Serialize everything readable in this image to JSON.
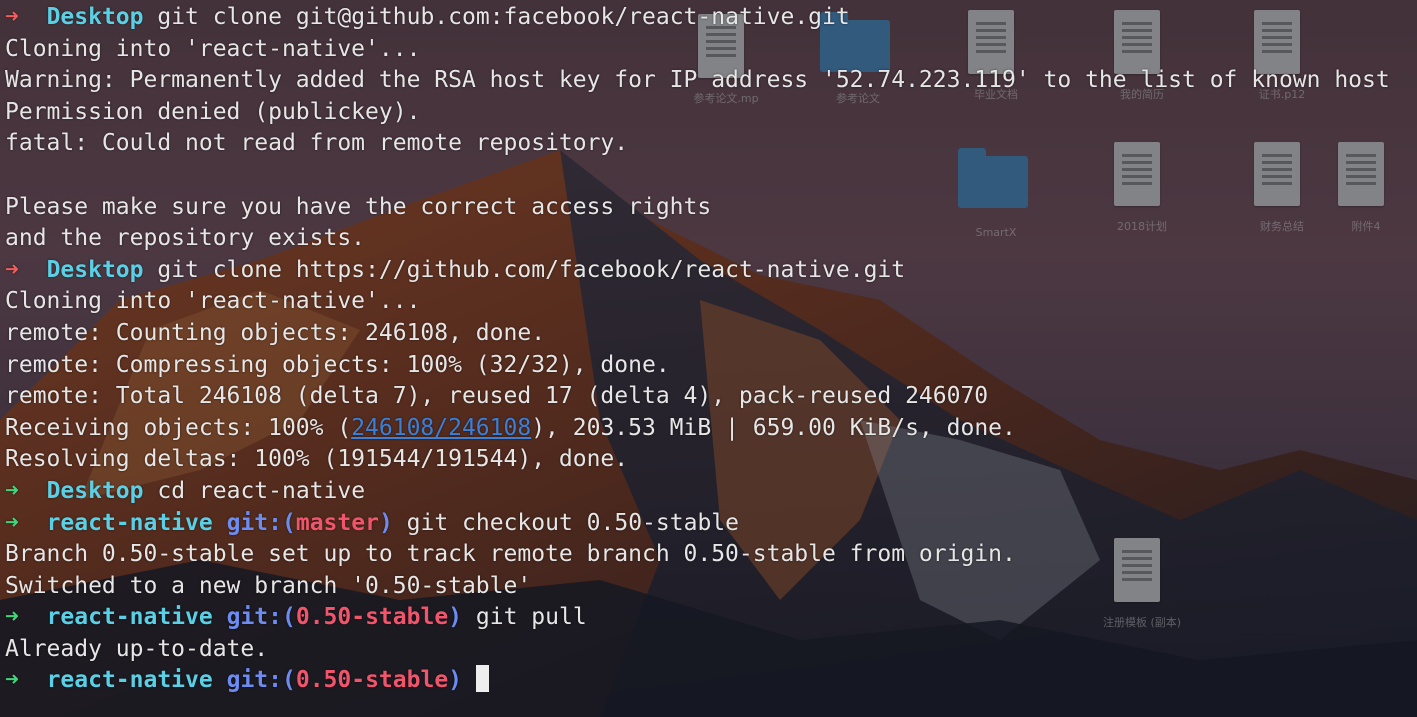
{
  "terminal": {
    "lines": [
      {
        "type": "prompt",
        "arrow": "err",
        "dir": "Desktop",
        "git": "",
        "branch": "",
        "git_end": "",
        "cmd": "git clone git@github.com:facebook/react-native.git"
      },
      {
        "type": "output",
        "text": "Cloning into 'react-native'..."
      },
      {
        "type": "output",
        "text": "Warning: Permanently added the RSA host key for IP address '52.74.223.119' to the list of known host"
      },
      {
        "type": "output",
        "text": "Permission denied (publickey)."
      },
      {
        "type": "output",
        "text": "fatal: Could not read from remote repository."
      },
      {
        "type": "output",
        "text": ""
      },
      {
        "type": "output",
        "text": "Please make sure you have the correct access rights"
      },
      {
        "type": "output",
        "text": "and the repository exists."
      },
      {
        "type": "prompt",
        "arrow": "err",
        "dir": "Desktop",
        "git": "",
        "branch": "",
        "git_end": "",
        "cmd": "git clone https://github.com/facebook/react-native.git"
      },
      {
        "type": "output",
        "text": "Cloning into 'react-native'..."
      },
      {
        "type": "output",
        "text": "remote: Counting objects: 246108, done."
      },
      {
        "type": "output",
        "text": "remote: Compressing objects: 100% (32/32), done."
      },
      {
        "type": "output",
        "text": "remote: Total 246108 (delta 7), reused 17 (delta 4), pack-reused 246070"
      },
      {
        "type": "receiving",
        "pre": "Receiving objects: 100% (",
        "link": "246108/246108",
        "post": "), 203.53 MiB | 659.00 KiB/s, done."
      },
      {
        "type": "output",
        "text": "Resolving deltas: 100% (191544/191544), done."
      },
      {
        "type": "prompt",
        "arrow": "ok",
        "dir": "Desktop",
        "git": "",
        "branch": "",
        "git_end": "",
        "cmd": "cd react-native"
      },
      {
        "type": "prompt",
        "arrow": "ok",
        "dir": "react-native",
        "git": "git:(",
        "branch": "master",
        "git_end": ")",
        "cmd": "git checkout 0.50-stable"
      },
      {
        "type": "output",
        "text": "Branch 0.50-stable set up to track remote branch 0.50-stable from origin."
      },
      {
        "type": "output",
        "text": "Switched to a new branch '0.50-stable'"
      },
      {
        "type": "prompt",
        "arrow": "ok",
        "dir": "react-native",
        "git": "git:(",
        "branch": "0.50-stable",
        "git_end": ")",
        "cmd": "git pull"
      },
      {
        "type": "output",
        "text": "Already up-to-date."
      },
      {
        "type": "prompt",
        "arrow": "ok",
        "dir": "react-native",
        "git": "git:(",
        "branch": "0.50-stable",
        "git_end": ")",
        "cmd": "",
        "cursor": true
      }
    ]
  },
  "desktop": {
    "icons": [
      {
        "kind": "doc",
        "label": "参考论文.mp",
        "icon": "document-icon"
      },
      {
        "kind": "folder",
        "label": "参考论文",
        "icon": "folder-icon"
      },
      {
        "kind": "doc",
        "label": "毕业文档",
        "icon": "document-icon"
      },
      {
        "kind": "doc",
        "label": "我的简历",
        "icon": "document-icon"
      },
      {
        "kind": "doc",
        "label": "证书.p12",
        "icon": "certificate-icon"
      },
      {
        "kind": "folder",
        "label": "SmartX",
        "icon": "folder-icon"
      },
      {
        "kind": "doc",
        "label": "2018计划",
        "icon": "document-icon"
      },
      {
        "kind": "doc",
        "label": "财务总结",
        "icon": "document-icon"
      },
      {
        "kind": "doc",
        "label": "附件4",
        "icon": "document-icon"
      },
      {
        "kind": "doc",
        "label": "注册模板 (副本)",
        "icon": "document-icon"
      }
    ]
  },
  "colors": {
    "arrow_ok": "#3fd67a",
    "arrow_err": "#f25c5c",
    "dir": "#5ad0e6",
    "git": "#6d8cf2",
    "branch": "#f0556b",
    "link": "#3b7fd6"
  }
}
